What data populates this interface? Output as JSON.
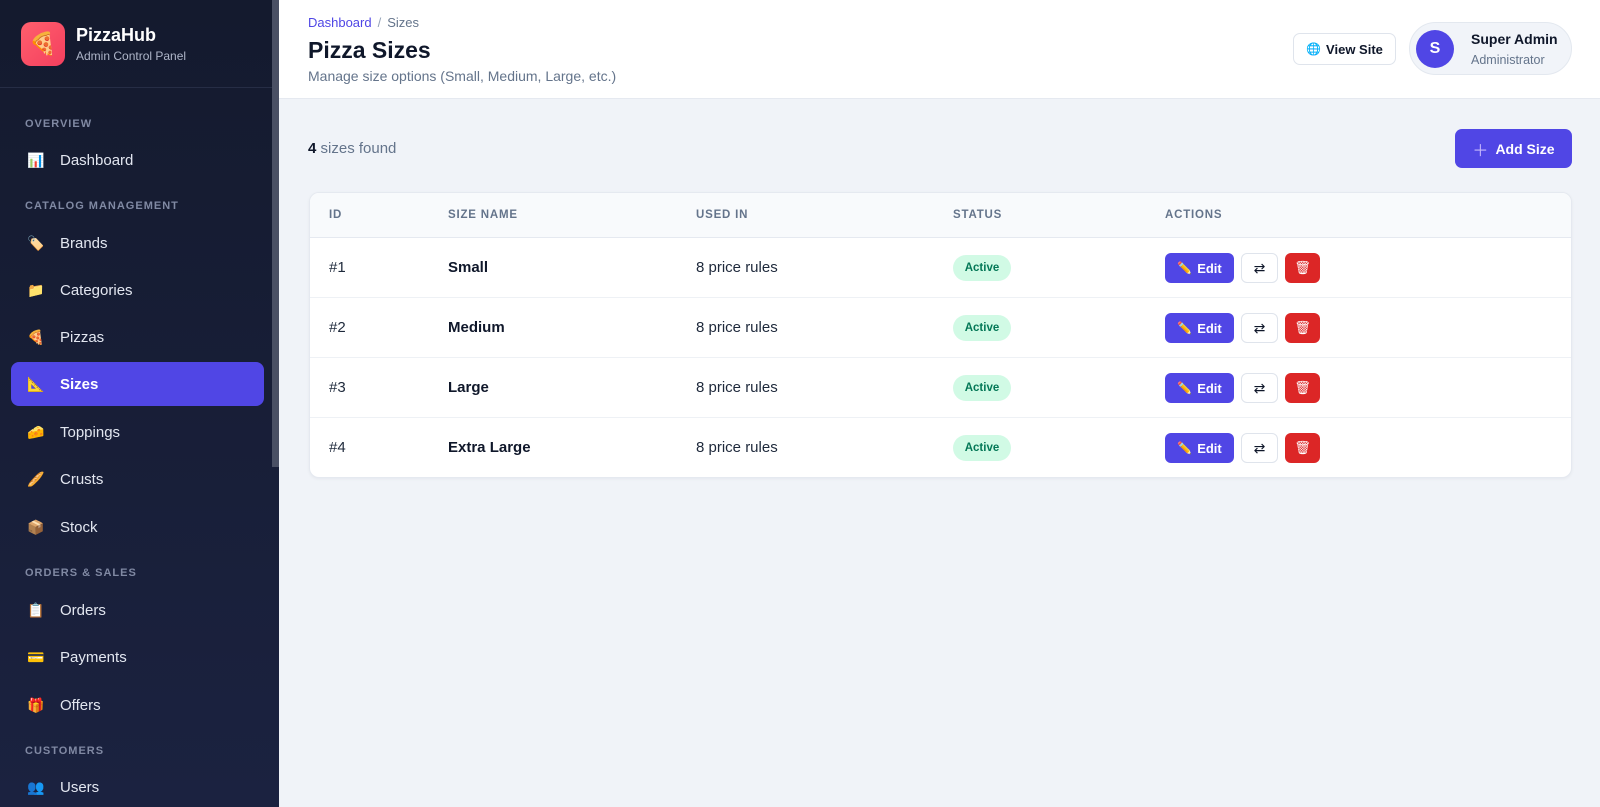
{
  "brand": {
    "name": "PizzaHub",
    "subtitle": "Admin Control Panel"
  },
  "sidebar": {
    "sections": [
      "OVERVIEW",
      "CATALOG MANAGEMENT",
      "ORDERS & SALES",
      "CUSTOMERS"
    ],
    "items": [
      {
        "label": "Dashboard",
        "icon": "chart-icon"
      },
      {
        "label": "Brands",
        "icon": "tag-icon"
      },
      {
        "label": "Categories",
        "icon": "folder-icon"
      },
      {
        "label": "Pizzas",
        "icon": "pizza-icon"
      },
      {
        "label": "Sizes",
        "icon": "ruler-icon",
        "active": true
      },
      {
        "label": "Toppings",
        "icon": "cheese-icon"
      },
      {
        "label": "Crusts",
        "icon": "bread-icon"
      },
      {
        "label": "Stock",
        "icon": "box-icon"
      },
      {
        "label": "Orders",
        "icon": "clipboard-icon"
      },
      {
        "label": "Payments",
        "icon": "card-icon"
      },
      {
        "label": "Offers",
        "icon": "gift-icon"
      },
      {
        "label": "Users",
        "icon": "users-icon"
      }
    ]
  },
  "header": {
    "breadcrumb": {
      "home": "Dashboard",
      "separator": "/",
      "current": "Sizes"
    },
    "title": "Pizza Sizes",
    "subtitle": "Manage size options (Small, Medium, Large, etc.)",
    "view_site": "View Site",
    "user": {
      "initial": "S",
      "name": "Super Admin",
      "role": "Administrator"
    }
  },
  "toolbar": {
    "count": "4",
    "count_label": "sizes found",
    "add_label": "Add Size"
  },
  "table": {
    "columns": [
      "ID",
      "SIZE NAME",
      "USED IN",
      "STATUS",
      "ACTIONS"
    ],
    "rows": [
      {
        "id": "#1",
        "name": "Small",
        "used": "8 price rules",
        "status": "Active"
      },
      {
        "id": "#2",
        "name": "Medium",
        "used": "8 price rules",
        "status": "Active"
      },
      {
        "id": "#3",
        "name": "Large",
        "used": "8 price rules",
        "status": "Active"
      },
      {
        "id": "#4",
        "name": "Extra Large",
        "used": "8 price rules",
        "status": "Active"
      }
    ],
    "edit_label": "Edit"
  },
  "colors": {
    "accent": "#5046e5",
    "danger": "#dc2626",
    "success_bg": "#d1fae5",
    "success_text": "#047857",
    "sidebar_bg": "#141a2e"
  }
}
